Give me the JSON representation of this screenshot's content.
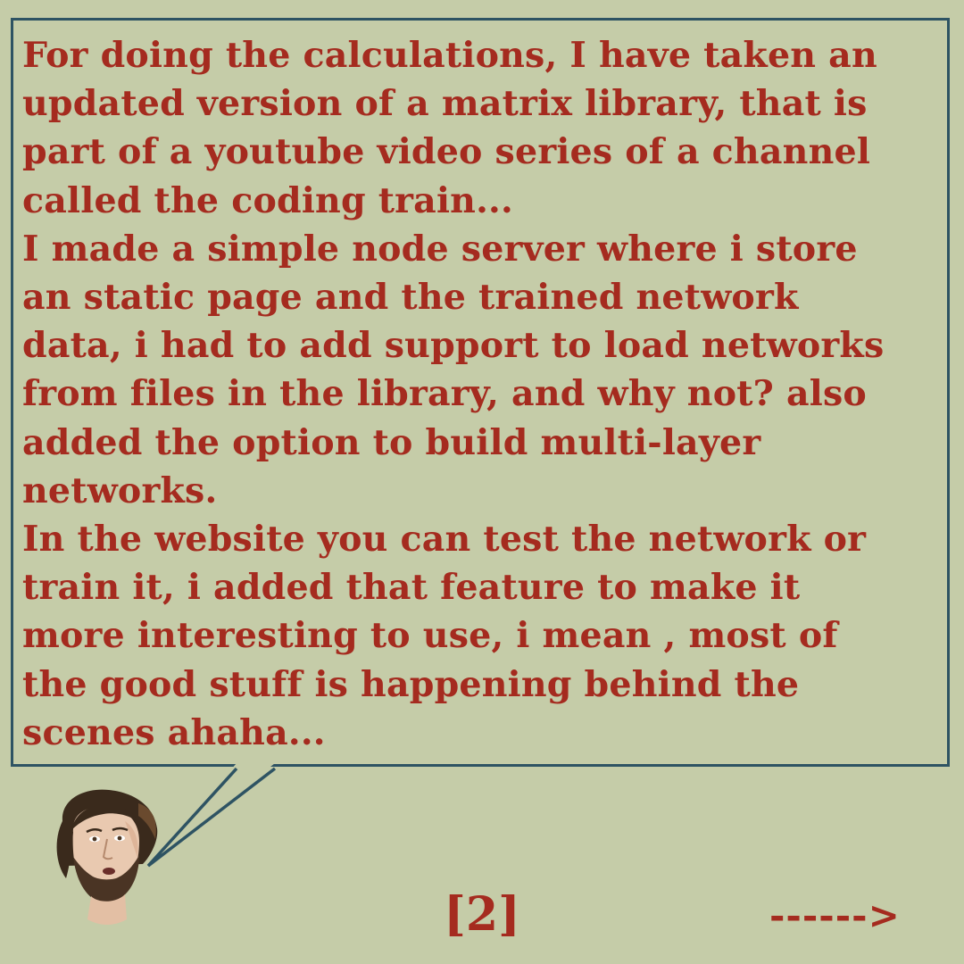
{
  "speech_bubble": {
    "text": "For doing the calculations, I have taken an\nupdated version of a matrix library, that is\npart of a youtube video series of a channel\ncalled the coding train...\nI made a simple node server where i store\nan static page and the trained network\ndata, i had to add support to load networks\nfrom files in the library, and why not? also\nadded the option to build  multi-layer\nnetworks.\nIn the website you can test the network or\ntrain it, i added that feature to make it\nmore interesting to use, i mean , most of\nthe good stuff is happening behind the\nscenes ahaha..."
  },
  "page_number": "[2]",
  "next_arrow": "------>",
  "colors": {
    "background": "#c5cca8",
    "text": "#a52b1f",
    "bubble_border": "#2e5363"
  },
  "icons": {
    "avatar": "speaker-portrait-avatar"
  }
}
